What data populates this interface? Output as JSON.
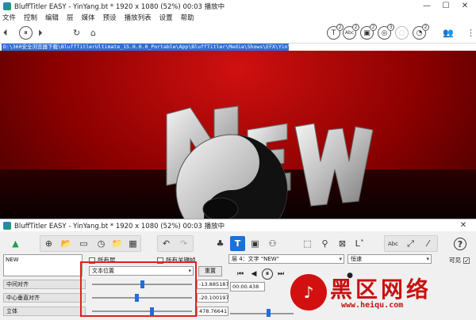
{
  "window": {
    "title": "BluffTitler EASY  - YinYang.bt * 1920 x 1080 (52%) 00:03 播放中",
    "minimize": "—",
    "maximize": "☐",
    "close": "✕"
  },
  "menu": [
    "文件",
    "控制",
    "编辑",
    "层",
    "媒体",
    "预设",
    "播放列表",
    "设置",
    "帮助"
  ],
  "toolbar": {
    "pause": "⏸",
    "refresh": "↻",
    "home": "⌂",
    "right_icons": [
      {
        "name": "text-icon",
        "glyph": "T",
        "badge": "2"
      },
      {
        "name": "abc-icon",
        "glyph": "Abc",
        "badge": "2"
      },
      {
        "name": "picture-icon",
        "glyph": "▣",
        "badge": "2"
      },
      {
        "name": "shapes-icon",
        "glyph": "◎",
        "badge": "3"
      },
      {
        "name": "disabled-icon",
        "glyph": "◌",
        "badge": ""
      },
      {
        "name": "gauge-icon",
        "glyph": "◔",
        "badge": "2"
      }
    ],
    "users": "👥",
    "more": "⋮"
  },
  "path": "D:\\360安全浏览器下载\\BluffTitlerUltimate_15.0.0.0_Portable\\App\\BluffTitler\\Media\\Shows\\EFX\\YinYang.bt",
  "panel": {
    "title": "BluffTitler EASY  - YinYang.bt * 1920 x 1080 (52%) 00:03 播放中",
    "close": "✕",
    "text_content": "NEW",
    "all_layers_label": "所有层",
    "all_keys_label": "所有关键帧",
    "layer_select": "层 4：文字 \"NEW\"",
    "speed_select": "恒速",
    "visible_label": "可见",
    "property_select": "文本位置",
    "reset_button": "重置",
    "props": [
      {
        "label": "中间对齐",
        "value": "-13.885187",
        "slider": 0.5
      },
      {
        "label": "中心垂直对齐",
        "value": "-20.100197",
        "slider": 0.45
      },
      {
        "label": "立体",
        "value": "478.76641",
        "slider": 0.6
      }
    ],
    "time": "00:00.438",
    "transport": {
      "first": "⏮",
      "pause": "⏸",
      "next": "⏭",
      "record": "●"
    }
  },
  "watermark": {
    "logo": "♪",
    "brand": "黑区网络",
    "url": "www.heiqu.com"
  }
}
